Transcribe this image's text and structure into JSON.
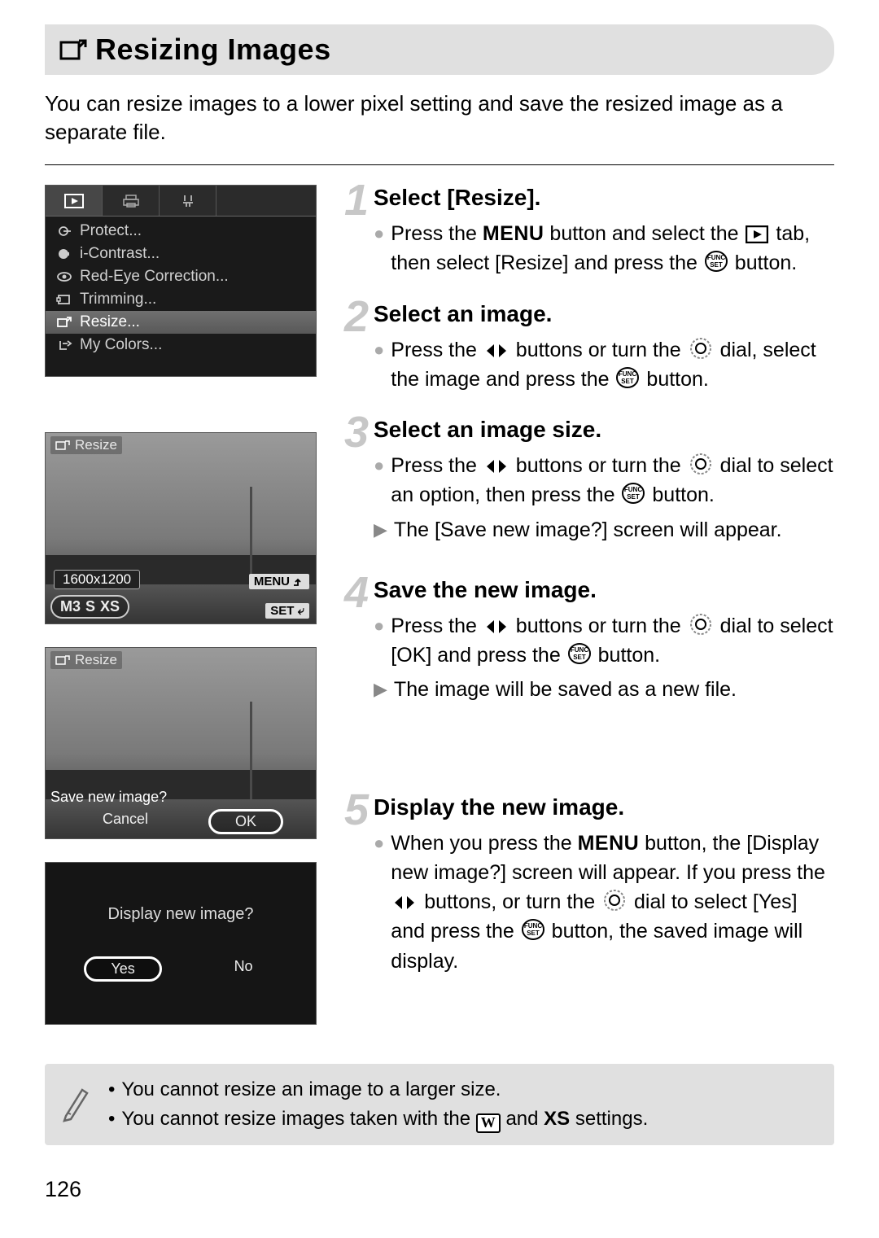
{
  "page": {
    "title": "Resizing Images",
    "intro": "You can resize images to a lower pixel setting and save the resized image as a separate file.",
    "page_number": "126"
  },
  "menu_screen": {
    "items": [
      {
        "label": "Protect..."
      },
      {
        "label": "i-Contrast..."
      },
      {
        "label": "Red-Eye Correction..."
      },
      {
        "label": "Trimming..."
      },
      {
        "label": "Resize...",
        "highlight": true
      },
      {
        "label": "My Colors..."
      }
    ]
  },
  "size_screen": {
    "header": "Resize",
    "resolution": "1600x1200",
    "menu_hint": "MENU",
    "set_hint": "SET",
    "sizes": {
      "m3": "M3",
      "s": "S",
      "xs": "XS"
    }
  },
  "save_screen": {
    "header": "Resize",
    "prompt": "Save new image?",
    "cancel": "Cancel",
    "ok": "OK"
  },
  "display_screen": {
    "prompt": "Display new image?",
    "yes": "Yes",
    "no": "No"
  },
  "steps": [
    {
      "num": "1",
      "title": "Select [Resize].",
      "body": [
        {
          "type": "dot",
          "html": "Press the {MENU} button and select the {PLAYTAB} tab, then select [Resize] and press the {FUNC} button."
        }
      ]
    },
    {
      "num": "2",
      "title": "Select an image.",
      "body": [
        {
          "type": "dot",
          "html": "Press the {LR} buttons or turn the {DIAL} dial, select the image and press the {FUNC} button."
        }
      ]
    },
    {
      "num": "3",
      "title": "Select an image size.",
      "body": [
        {
          "type": "dot",
          "html": "Press the {LR} buttons or turn the {DIAL} dial to select an option, then press the {FUNC} button."
        },
        {
          "type": "arrow",
          "html": "The [Save new image?] screen will appear."
        }
      ]
    },
    {
      "num": "4",
      "title": "Save the new image.",
      "body": [
        {
          "type": "dot",
          "html": "Press the {LR} buttons or turn the {DIAL} dial to select [OK] and press the {FUNC} button."
        },
        {
          "type": "arrow",
          "html": "The image will be saved as a new file."
        }
      ]
    },
    {
      "num": "5",
      "title": "Display the new image.",
      "body": [
        {
          "type": "dot",
          "html": "When you press the {MENU} button, the [Display new image?] screen will appear. If you press the {LR} buttons, or turn the {DIAL} dial to select [Yes] and press the {FUNC} button, the saved image will display."
        }
      ]
    }
  ],
  "notes": [
    "You cannot resize an image to a larger size.",
    "You cannot resize images taken with the {W} and {XS} settings."
  ]
}
